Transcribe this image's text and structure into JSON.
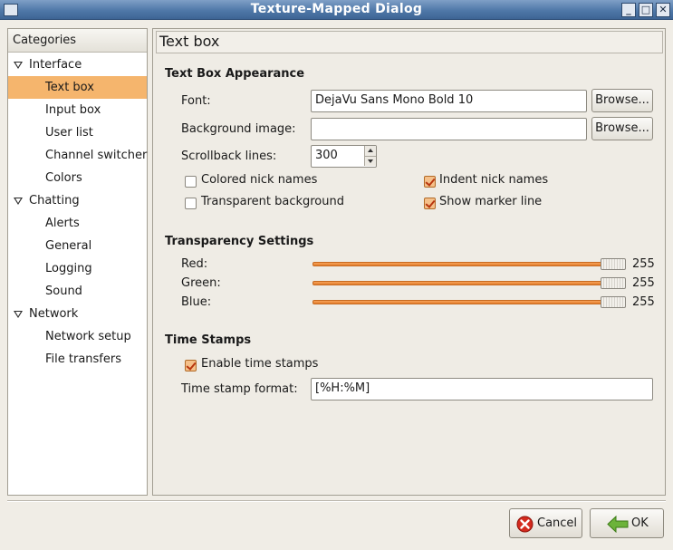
{
  "window": {
    "title": "Texture-Mapped Dialog"
  },
  "sidebar": {
    "header": "Categories",
    "categories": [
      {
        "label": "Interface",
        "items": [
          "Text box",
          "Input box",
          "User list",
          "Channel switcher",
          "Colors"
        ]
      },
      {
        "label": "Chatting",
        "items": [
          "Alerts",
          "General",
          "Logging",
          "Sound"
        ]
      },
      {
        "label": "Network",
        "items": [
          "Network setup",
          "File transfers"
        ]
      }
    ],
    "selected": "Text box"
  },
  "page": {
    "title": "Text box",
    "appearance": {
      "heading": "Text Box Appearance",
      "font_label": "Font:",
      "font_value": "DejaVu Sans Mono Bold 10",
      "browse_label": "Browse...",
      "bg_image_label": "Background image:",
      "bg_image_value": "",
      "scrollback_label": "Scrollback lines:",
      "scrollback_value": "300",
      "checkboxes": {
        "colored_nick_names": {
          "label": "Colored nick names",
          "checked": false
        },
        "indent_nick_names": {
          "label": "Indent nick names",
          "checked": true
        },
        "transparent_background": {
          "label": "Transparent background",
          "checked": false
        },
        "show_marker_line": {
          "label": "Show marker line",
          "checked": true
        }
      }
    },
    "transparency": {
      "heading": "Transparency Settings",
      "red": {
        "label": "Red:",
        "value": "255",
        "max": 255
      },
      "green": {
        "label": "Green:",
        "value": "255",
        "max": 255
      },
      "blue": {
        "label": "Blue:",
        "value": "255",
        "max": 255
      }
    },
    "timestamps": {
      "heading": "Time Stamps",
      "enable": {
        "label": "Enable time stamps",
        "checked": true
      },
      "format_label": "Time stamp format:",
      "format_value": "[%H:%M]"
    }
  },
  "footer": {
    "cancel_label": "Cancel",
    "ok_label": "OK"
  },
  "colors": {
    "selection": "#f5b56d",
    "slider": "#e27d2b",
    "titlebar": "#4f78a8"
  }
}
